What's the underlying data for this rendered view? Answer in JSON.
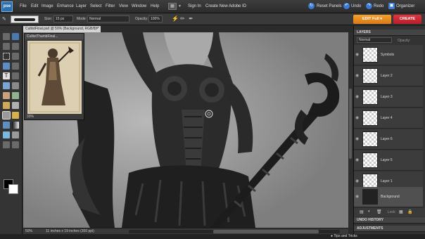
{
  "app": {
    "logo": "pse"
  },
  "menu": [
    "File",
    "Edit",
    "Image",
    "Enhance",
    "Layer",
    "Select",
    "Filter",
    "View",
    "Window",
    "Help"
  ],
  "top": {
    "sign_in": "Sign In",
    "create_id": "Create New Adobe ID",
    "reset_panels": "Reset Panels",
    "undo": "Undo",
    "redo": "Redo",
    "organizer": "Organizer"
  },
  "options": {
    "size_label": "Size:",
    "size_value": "15 px",
    "mode_label": "Mode:",
    "mode_value": "Normal",
    "opacity_label": "Opacity:",
    "opacity_value": "100%"
  },
  "edit_full": "EDIT Full",
  "create": "CREATE",
  "document": {
    "tab_title": "CultistFinal.psd @ 50% (Background, RGB/8) *",
    "zoom": "50%",
    "info": "11 inches x 19 inches (300 ppi)"
  },
  "thumbnail": {
    "title": "CultistThumbFinal...",
    "zoom": "33%"
  },
  "layers_panel": {
    "title": "LAYERS",
    "blend": "Normal",
    "opacity_label": "Opacity:",
    "lock_label": "Lock:",
    "layers": [
      {
        "name": "Symbols"
      },
      {
        "name": "Layer 2"
      },
      {
        "name": "Layer 3"
      },
      {
        "name": "Layer 4"
      },
      {
        "name": "Layer 6"
      },
      {
        "name": "Layer 5"
      },
      {
        "name": "Layer 1"
      },
      {
        "name": "Background"
      }
    ]
  },
  "undo_history": "UNDO HISTORY",
  "adjustments": "ADJUSTMENTS",
  "tips": "Tips and Tricks"
}
